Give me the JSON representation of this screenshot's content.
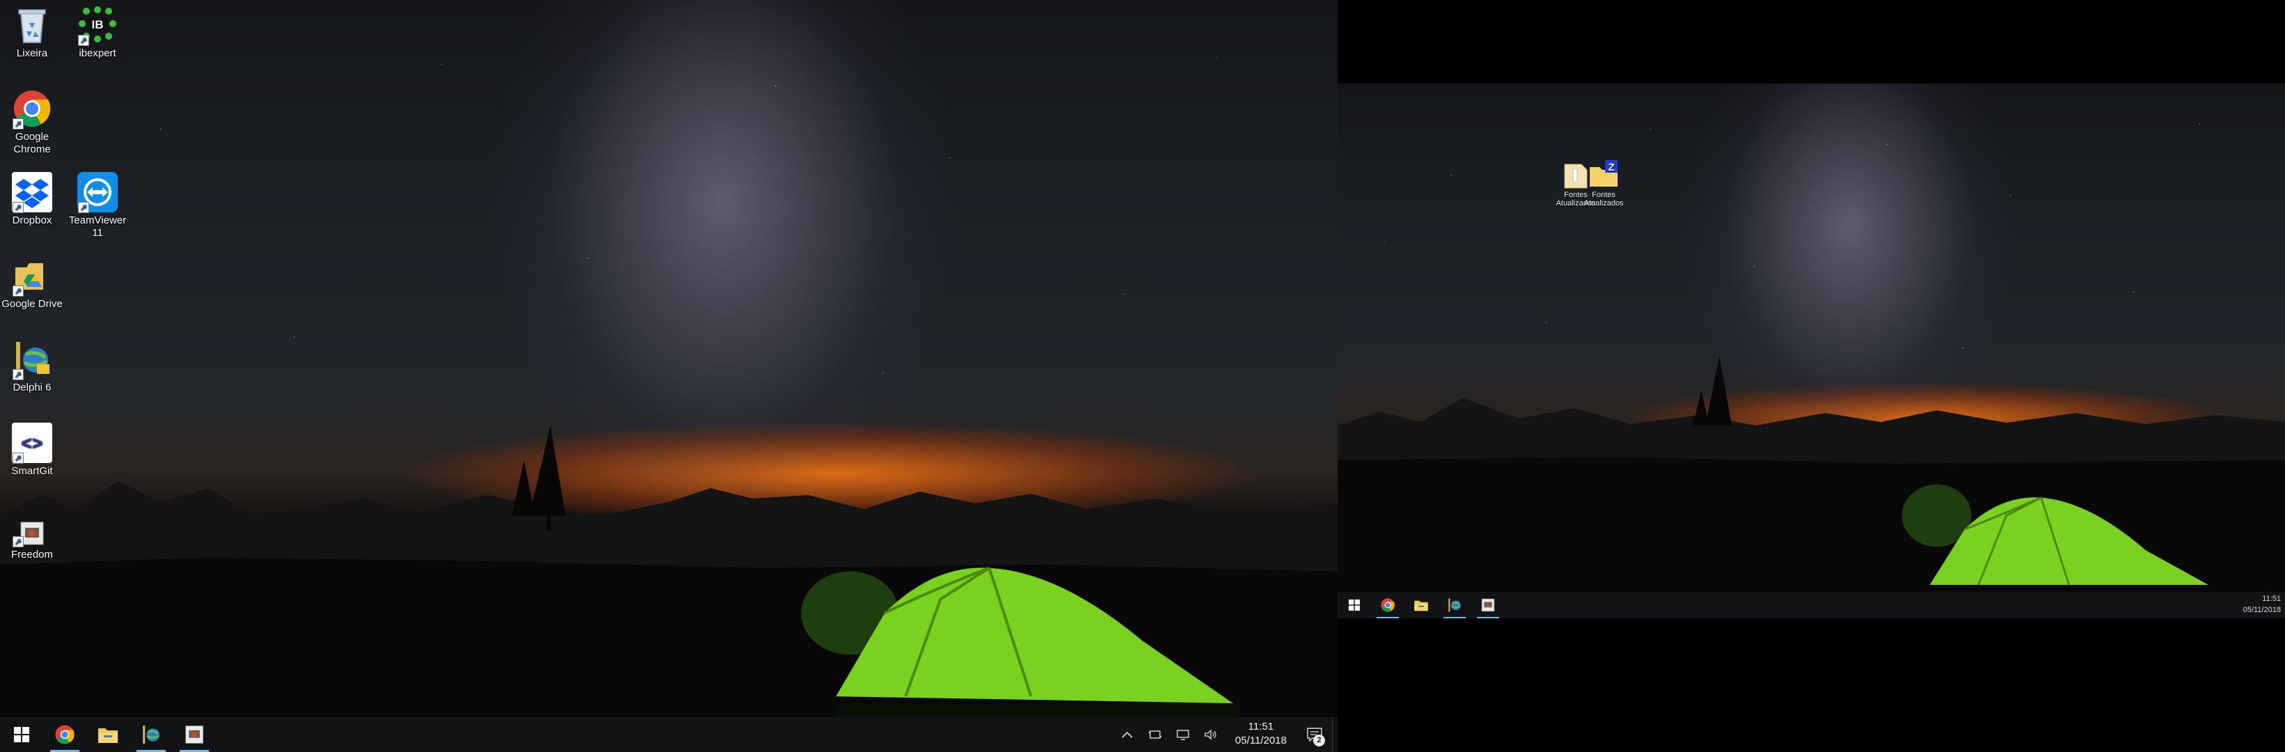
{
  "monitor_1": {
    "desktop_icons": [
      {
        "id": "recycle-bin",
        "label": "Lixeira",
        "icon": "recycle-bin-icon"
      },
      {
        "id": "ibexpert",
        "label": "ibexpert",
        "icon": "ibexpert-icon",
        "icon_text": "IB"
      },
      {
        "id": "google-chrome",
        "label": "Google Chrome",
        "icon": "chrome-icon"
      },
      {
        "id": "dropbox",
        "label": "Dropbox",
        "icon": "dropbox-icon"
      },
      {
        "id": "teamviewer",
        "label": "TeamViewer 11",
        "icon": "teamviewer-icon"
      },
      {
        "id": "google-drive",
        "label": "Google Drive",
        "icon": "google-drive-icon"
      },
      {
        "id": "delphi",
        "label": "Delphi 6",
        "icon": "delphi-icon"
      },
      {
        "id": "smartgit",
        "label": "SmartGit",
        "icon": "smartgit-icon",
        "icon_text": "<>"
      },
      {
        "id": "freedom",
        "label": "Freedom",
        "icon": "freedom-icon"
      }
    ],
    "taskbar": {
      "pinned": [
        {
          "id": "start",
          "icon": "windows-start-icon",
          "active": false
        },
        {
          "id": "chrome",
          "icon": "chrome-icon",
          "active": true
        },
        {
          "id": "explorer",
          "icon": "file-explorer-icon",
          "active": false
        },
        {
          "id": "delphi",
          "icon": "delphi-icon",
          "active": true
        },
        {
          "id": "freedom",
          "icon": "freedom-icon",
          "active": true
        }
      ],
      "tray": {
        "icons": [
          "chevron-up-icon",
          "tablet-icon",
          "display-icon",
          "volume-icon"
        ],
        "time": "11:51",
        "date": "05/11/2018",
        "notifications_count": "2"
      }
    }
  },
  "monitor_2": {
    "desktop_icons": [
      {
        "id": "folder-1",
        "label": "Fontes Atualizados",
        "icon": "document-folder-icon"
      },
      {
        "id": "folder-2",
        "label": "Fontes Atualizados",
        "icon": "zip-folder-icon"
      }
    ],
    "taskbar": {
      "time": "11:51",
      "date": "05/11/2018"
    }
  },
  "colors": {
    "taskbar": "#121315",
    "active_indicator": "#76b9ed",
    "tent_green": "#7bd11f",
    "horizon_orange": "#ff7a14"
  }
}
